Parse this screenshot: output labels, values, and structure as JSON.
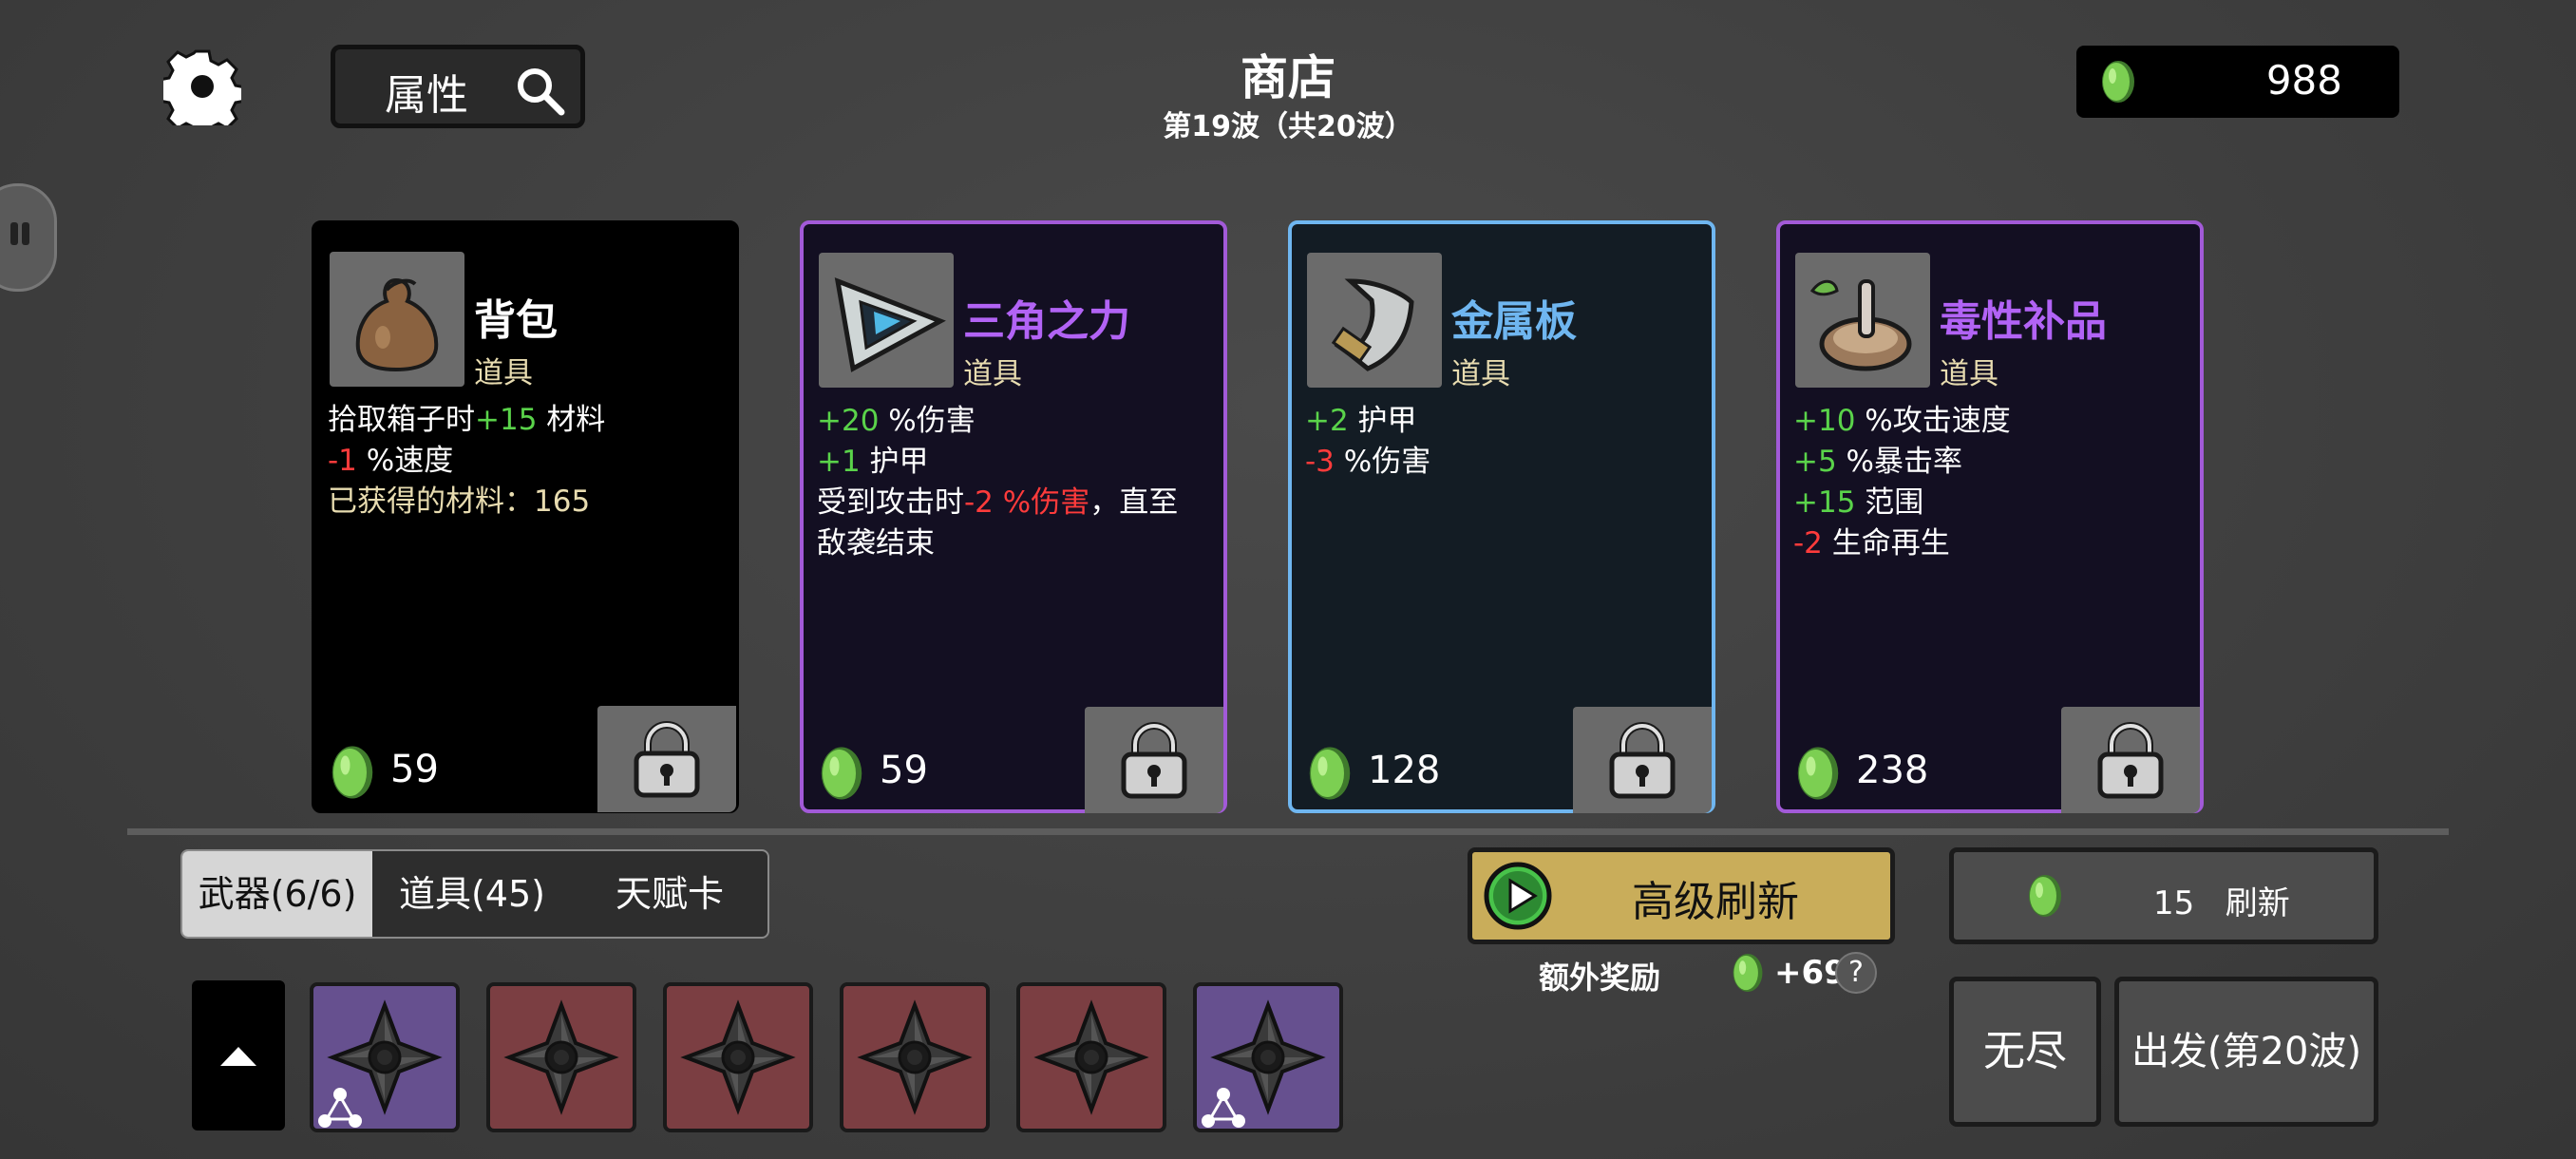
{
  "header": {
    "title": "商店",
    "wave": "第19波（共20波）",
    "search_label": "属性",
    "currency": "988"
  },
  "cards": [
    {
      "name": "背包",
      "name_color": "#ffffff",
      "type": "道具",
      "rarity": "common",
      "icon": "bag-icon",
      "stats": [
        {
          "prefix": "拾取箱子时",
          "value": "+15",
          "suffix": " 材料"
        },
        {
          "prefix": "",
          "value": "-1",
          "suffix": " %速度"
        },
        {
          "prefix": "已获得的材料：165",
          "value": "",
          "suffix": ""
        }
      ],
      "price": "59"
    },
    {
      "name": "三角之力",
      "name_color": "#b263f5",
      "type": "道具",
      "rarity": "epic",
      "icon": "triangle-icon",
      "stats": [
        {
          "prefix": "",
          "value": "+20",
          "suffix": " %伤害"
        },
        {
          "prefix": "",
          "value": "+1",
          "suffix": " 护甲"
        },
        {
          "prefix": "受到攻击时",
          "value": "-2 %伤害",
          "suffix": "，直至"
        },
        {
          "prefix": "敌袭结束",
          "value": "",
          "suffix": ""
        }
      ],
      "price": "59"
    },
    {
      "name": "金属板",
      "name_color": "#6fb6f0",
      "type": "道具",
      "rarity": "rare",
      "icon": "metal-plate-icon",
      "stats": [
        {
          "prefix": "",
          "value": "+2",
          "suffix": " 护甲"
        },
        {
          "prefix": "",
          "value": "-3",
          "suffix": " %伤害"
        }
      ],
      "price": "128"
    },
    {
      "name": "毒性补品",
      "name_color": "#b263f5",
      "type": "道具",
      "rarity": "epic",
      "icon": "toxic-tonic-icon",
      "stats": [
        {
          "prefix": "",
          "value": "+10",
          "suffix": " %攻击速度"
        },
        {
          "prefix": "",
          "value": "+5",
          "suffix": " %暴击率"
        },
        {
          "prefix": "",
          "value": "+15",
          "suffix": " 范围"
        },
        {
          "prefix": "",
          "value": "-2",
          "suffix": " 生命再生"
        }
      ],
      "price": "238"
    }
  ],
  "tabs": [
    {
      "label": "武器(6/6)",
      "active": true
    },
    {
      "label": "道具(45)",
      "active": false
    },
    {
      "label": "天赋卡",
      "active": false
    }
  ],
  "inventory": [
    {
      "item": "shuriken-icon",
      "tier": "purple"
    },
    {
      "item": "shuriken-icon",
      "tier": "red"
    },
    {
      "item": "shuriken-icon",
      "tier": "red"
    },
    {
      "item": "shuriken-icon",
      "tier": "red"
    },
    {
      "item": "shuriken-icon",
      "tier": "red"
    },
    {
      "item": "shuriken-icon",
      "tier": "purple"
    }
  ],
  "actions": {
    "advanced_refresh": "高级刷新",
    "bonus_label": "额外奖励",
    "bonus_amount": "+692",
    "help": "?",
    "refresh_cost": "15",
    "refresh_label": "刷新",
    "endless": "无尽",
    "depart": "出发(第20波)"
  },
  "colors": {
    "positive": "#5ad34a",
    "negative": "#ff3b3b",
    "epic_border": "#a25ad8",
    "rare_border": "#6fb6f0",
    "gold_button": "#c9ad5a"
  }
}
